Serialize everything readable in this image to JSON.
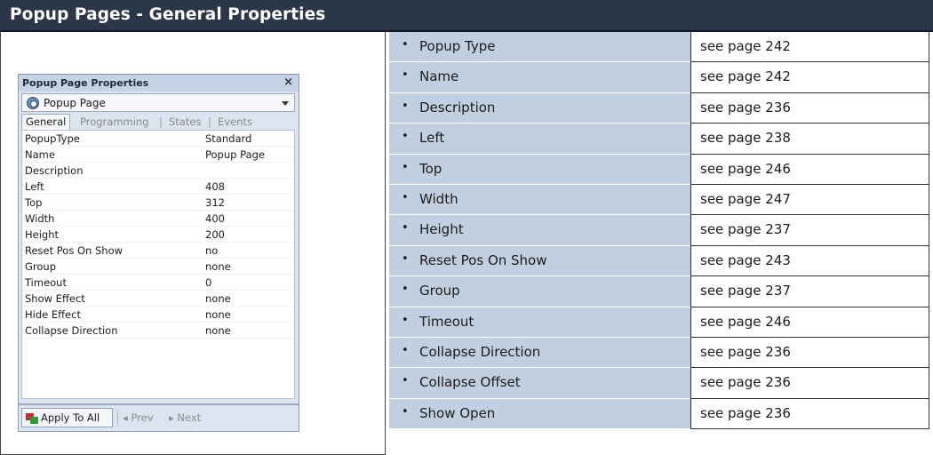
{
  "header": {
    "title": "Popup Pages - General Properties"
  },
  "panel": {
    "title": "Popup Page Properties",
    "close_glyph": "×",
    "combo_value": "Popup Page",
    "combo_icon": "popup-page-icon",
    "tabs": [
      "General",
      "Programming",
      "States",
      "Events"
    ],
    "tab_sep": "|",
    "rows": [
      {
        "key": "PopupType",
        "value": "Standard"
      },
      {
        "key": "Name",
        "value": "Popup Page"
      },
      {
        "key": "Description",
        "value": ""
      },
      {
        "key": "Left",
        "value": "408"
      },
      {
        "key": "Top",
        "value": "312"
      },
      {
        "key": "Width",
        "value": "400"
      },
      {
        "key": "Height",
        "value": "200"
      },
      {
        "key": "Reset Pos On Show",
        "value": "no"
      },
      {
        "key": "Group",
        "value": "none"
      },
      {
        "key": "Timeout",
        "value": "0"
      },
      {
        "key": "Show Effect",
        "value": "none"
      },
      {
        "key": "Hide Effect",
        "value": "none"
      },
      {
        "key": "Collapse Direction",
        "value": "none"
      }
    ],
    "apply_label": "Apply To All",
    "prev_label": "◂ Prev",
    "next_label": "▸ Next"
  },
  "table": {
    "bullet": "•",
    "rows": [
      {
        "property": "Popup Type",
        "ref": "see page 242"
      },
      {
        "property": "Name",
        "ref": "see page 242"
      },
      {
        "property": "Description",
        "ref": "see page 236"
      },
      {
        "property": "Left",
        "ref": "see page 238"
      },
      {
        "property": "Top",
        "ref": "see page 246"
      },
      {
        "property": "Width",
        "ref": "see page 247"
      },
      {
        "property": "Height",
        "ref": "see page 237"
      },
      {
        "property": "Reset Pos On Show",
        "ref": "see page 243"
      },
      {
        "property": "Group",
        "ref": "see page 237"
      },
      {
        "property": "Timeout",
        "ref": "see page 246"
      },
      {
        "property": "Collapse Direction",
        "ref": "see page 236"
      },
      {
        "property": "Collapse Offset",
        "ref": "see page 236"
      },
      {
        "property": "Show Open",
        "ref": "see page 236"
      }
    ]
  },
  "colors": {
    "header_bg": "#2b3648",
    "property_cell_bg": "#c2cfe0",
    "panel_bg": "#dbe4ef"
  }
}
